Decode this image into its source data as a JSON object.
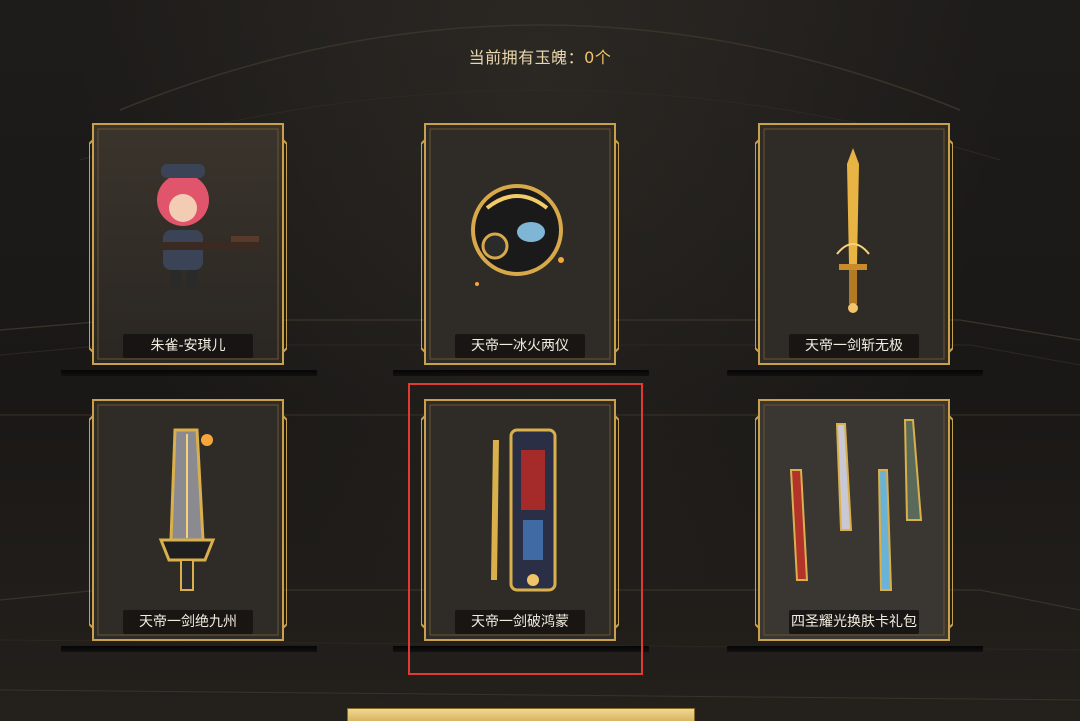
{
  "header": {
    "label": "当前拥有玉魄：",
    "count": "0个"
  },
  "cards": [
    {
      "label": "朱雀-安琪儿",
      "art_icon": "character-girl-with-rifle-icon"
    },
    {
      "label": "天帝一冰火两仪",
      "art_icon": "helmet-orb-icon"
    },
    {
      "label": "天帝一剑斩无极",
      "art_icon": "golden-sword-icon"
    },
    {
      "label": "天帝一剑绝九州",
      "art_icon": "golden-greatsword-icon"
    },
    {
      "label": "天帝一剑破鸿蒙",
      "art_icon": "twin-weapon-icon"
    },
    {
      "label": "四圣耀光换肤卡礼包",
      "art_icon": "four-weapons-icon"
    }
  ],
  "colors": {
    "gold": "#c9a04c",
    "highlight": "#e03a32",
    "label_text": "#f3ece0"
  }
}
